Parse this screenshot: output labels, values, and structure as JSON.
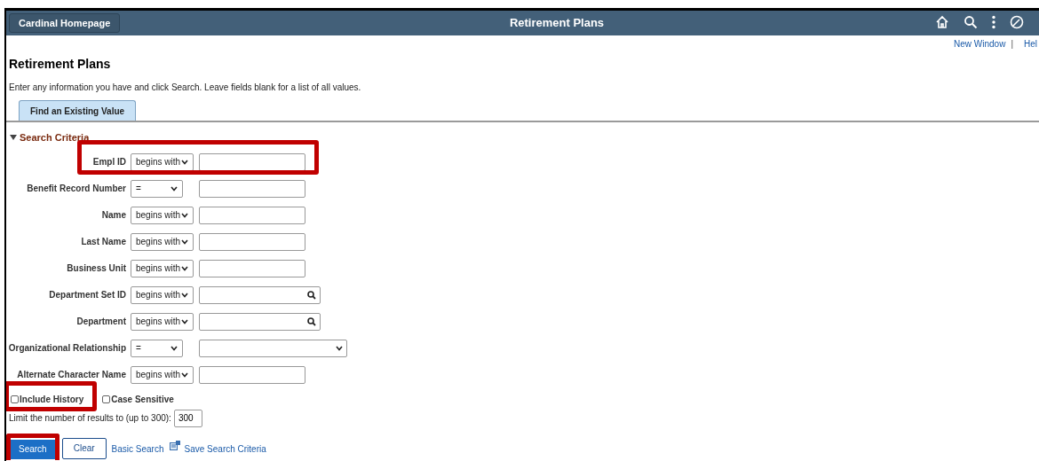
{
  "header": {
    "home_button": "Cardinal Homepage",
    "title": "Retirement Plans"
  },
  "header_links": [
    "New Window",
    "|",
    "Hel"
  ],
  "page_title": "Retirement Plans",
  "instructions": "Enter any information you have and click Search. Leave fields blank for a list of all values.",
  "tabs": [
    {
      "label": "Find an Existing Value",
      "selected": true
    }
  ],
  "section": {
    "label": "Search Criteria",
    "expanded": true
  },
  "fields": [
    {
      "label": "Empl ID",
      "operator": "begins with",
      "kind": "text",
      "highlighted": true
    },
    {
      "label": "Benefit Record Number",
      "operator": "=",
      "kind": "text",
      "highlighted": false
    },
    {
      "label": "Name",
      "operator": "begins with",
      "kind": "text",
      "highlighted": false
    },
    {
      "label": "Last Name",
      "operator": "begins with",
      "kind": "text",
      "highlighted": false
    },
    {
      "label": "Business Unit",
      "operator": "begins with",
      "kind": "text",
      "highlighted": false
    },
    {
      "label": "Department Set ID",
      "operator": "begins with",
      "kind": "lookup",
      "highlighted": false
    },
    {
      "label": "Department",
      "operator": "begins with",
      "kind": "lookup",
      "highlighted": false
    },
    {
      "label": "Organizational Relationship",
      "operator": "=",
      "kind": "dropdown",
      "highlighted": false
    },
    {
      "label": "Alternate Character Name",
      "operator": "begins with",
      "kind": "text",
      "highlighted": false
    }
  ],
  "checkboxes": [
    {
      "label": "Include History",
      "checked": false,
      "highlighted": true
    },
    {
      "label": "Case Sensitive",
      "checked": false,
      "highlighted": false
    }
  ],
  "limit": {
    "label": "Limit the number of results to (up to 300):",
    "value": "300"
  },
  "actions": [
    {
      "label": "Search",
      "kind": "primary",
      "highlighted": true
    },
    {
      "label": "Clear",
      "kind": "secondary",
      "highlighted": false
    },
    {
      "label": "Basic Search",
      "kind": "link",
      "highlighted": false
    },
    {
      "label": "Save Search Criteria",
      "kind": "icon-link",
      "highlighted": false
    }
  ]
}
